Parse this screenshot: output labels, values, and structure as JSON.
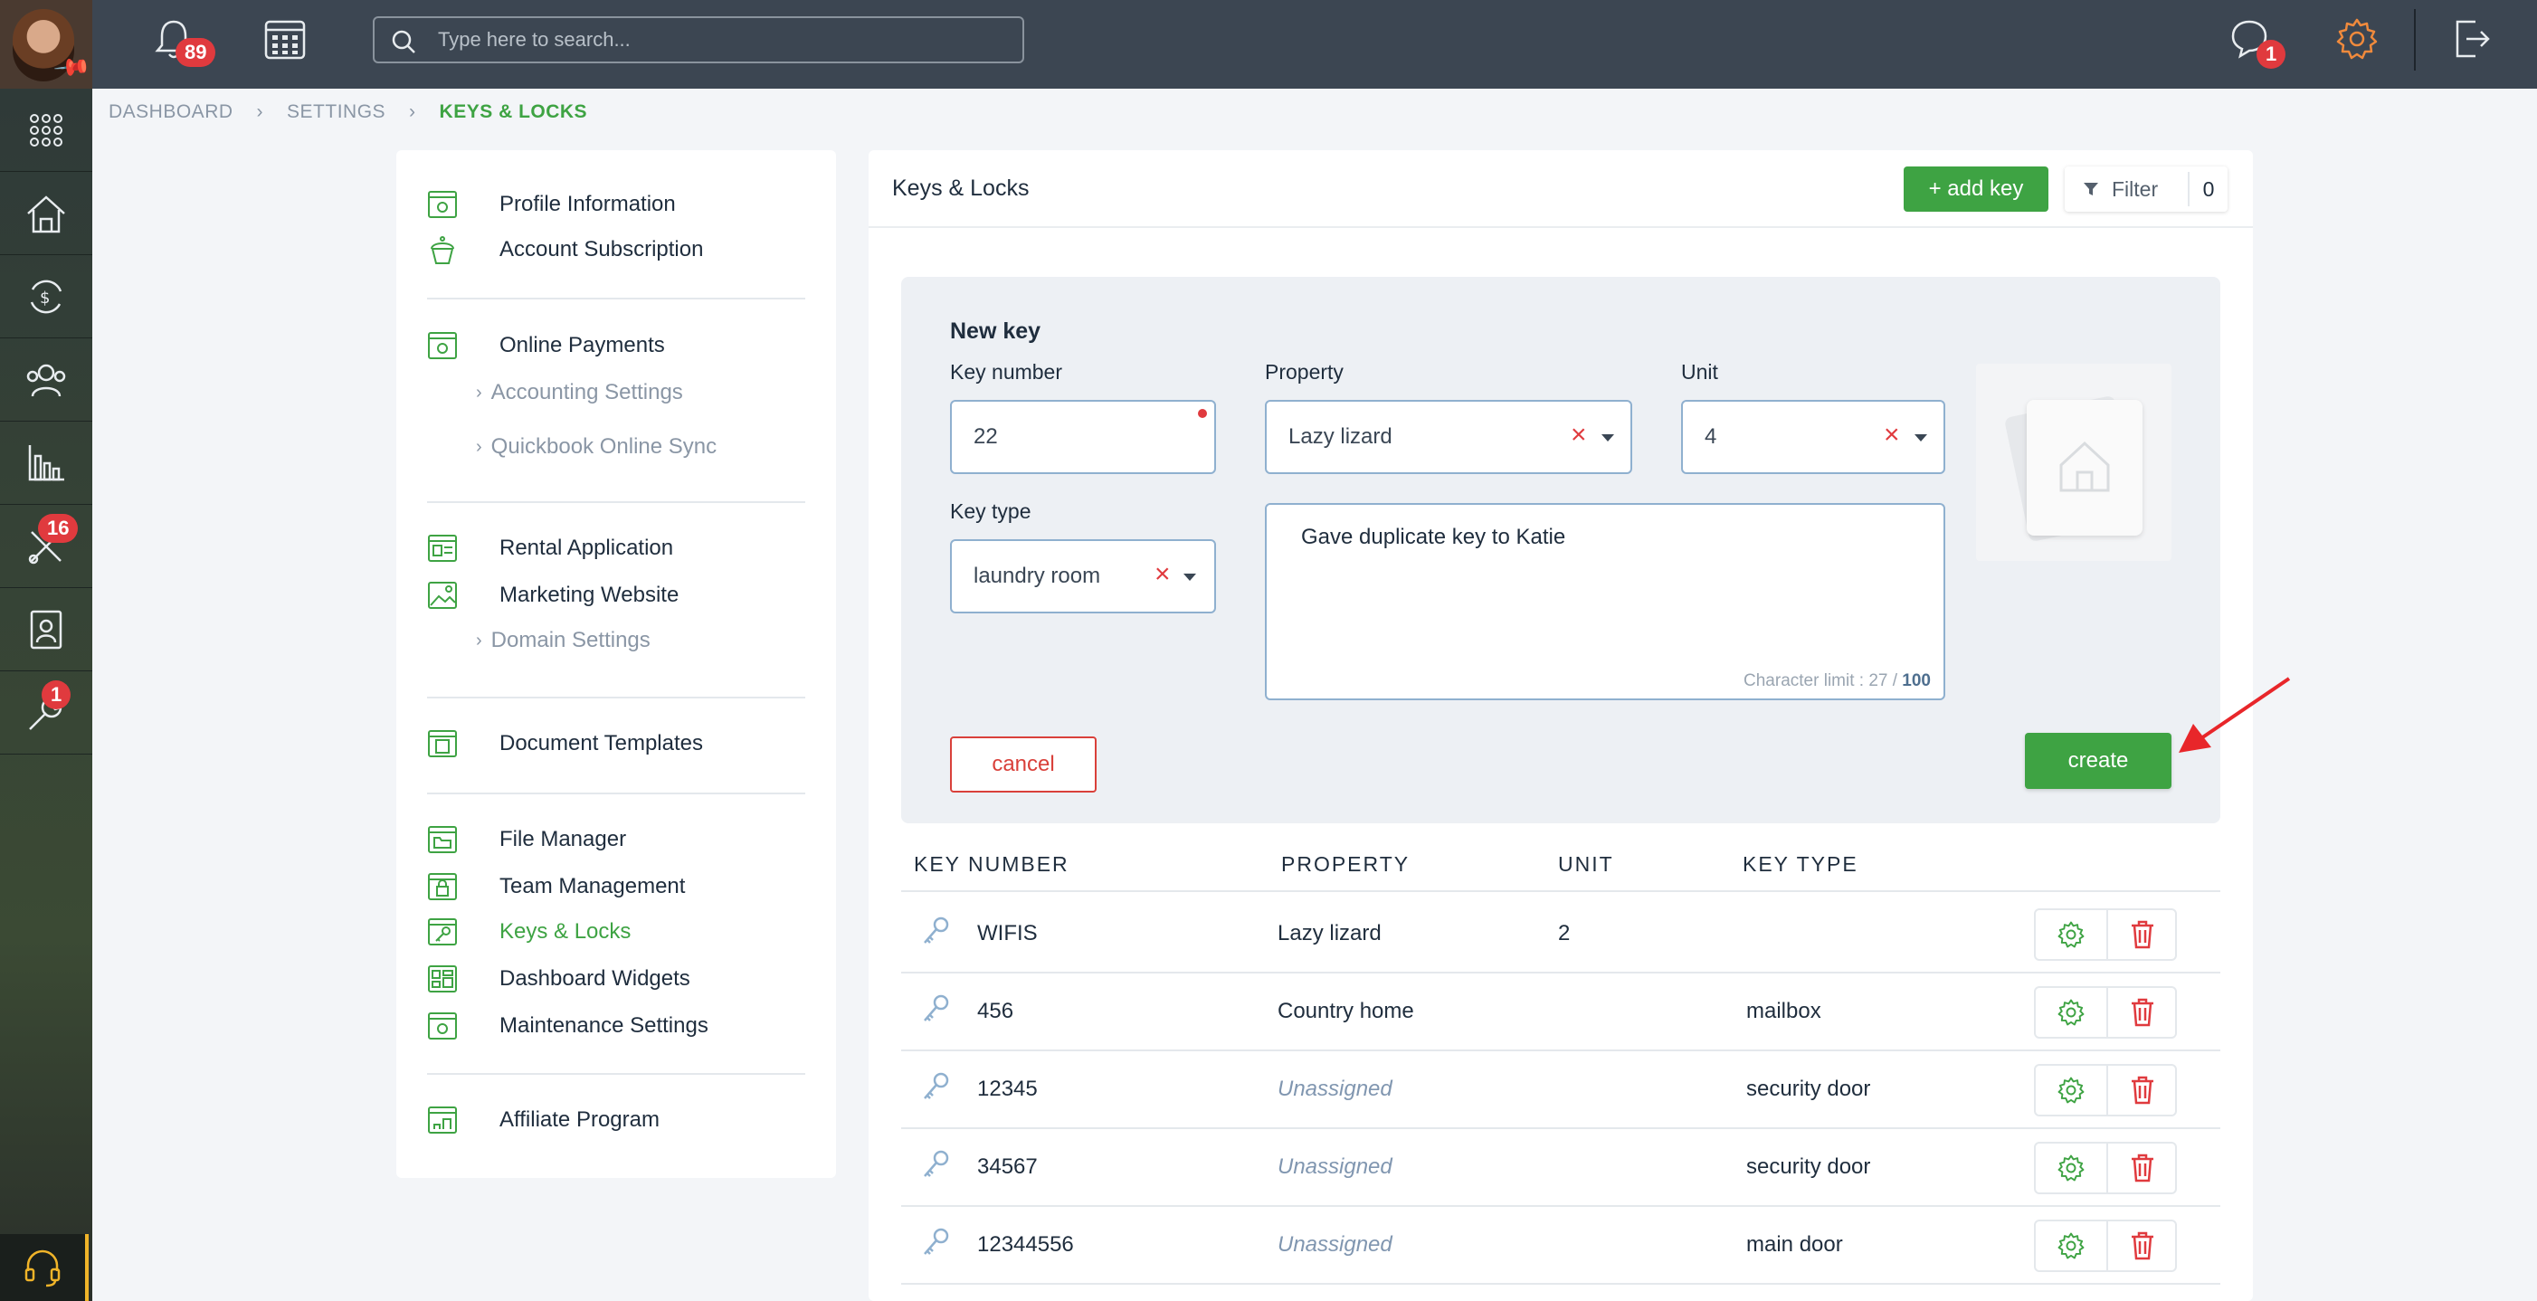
{
  "topbar": {
    "notifications_count": "89",
    "search_placeholder": "Type here to search...",
    "messages_count": "1"
  },
  "rail": {
    "maintenance_badge": "16",
    "tools_badge": "1"
  },
  "breadcrumb": [
    "DASHBOARD",
    "SETTINGS",
    "KEYS & LOCKS"
  ],
  "menu": {
    "profile": "Profile Information",
    "subscription": "Account Subscription",
    "online_payments": "Online Payments",
    "accounting": "Accounting Settings",
    "quickbook": "Quickbook Online Sync",
    "rental_app": "Rental Application",
    "marketing": "Marketing Website",
    "domain": "Domain Settings",
    "documents": "Document Templates",
    "file_manager": "File Manager",
    "team": "Team Management",
    "keys": "Keys & Locks",
    "widgets": "Dashboard Widgets",
    "maintenance": "Maintenance Settings",
    "affiliate": "Affiliate Program"
  },
  "header": {
    "title": "Keys & Locks",
    "add_key": "+ add key",
    "filter": "Filter",
    "filter_count": "0"
  },
  "form": {
    "title": "New key",
    "key_number_label": "Key number",
    "key_number_value": "22",
    "property_label": "Property",
    "property_value": "Lazy lizard",
    "unit_label": "Unit",
    "unit_value": "4",
    "key_type_label": "Key type",
    "key_type_value": "laundry room",
    "notes_value": "Gave duplicate key to Katie",
    "char_limit_prefix": "Character limit : 27 / ",
    "char_limit_max": "100",
    "cancel": "cancel",
    "create": "create"
  },
  "table": {
    "headers": [
      "KEY NUMBER",
      "PROPERTY",
      "UNIT",
      "KEY TYPE"
    ],
    "rows": [
      {
        "key": "WIFIS",
        "property": "Lazy lizard",
        "unit": "2",
        "type": ""
      },
      {
        "key": "456",
        "property": "Country home",
        "unit": "",
        "type": "mailbox"
      },
      {
        "key": "12345",
        "property": "Unassigned",
        "unit": "",
        "type": "security door"
      },
      {
        "key": "34567",
        "property": "Unassigned",
        "unit": "",
        "type": "security door"
      },
      {
        "key": "12344556",
        "property": "Unassigned",
        "unit": "",
        "type": "main door"
      }
    ]
  },
  "colors": {
    "accent": "#3ea343",
    "danger": "#e03a3e",
    "topbar": "#3c4652"
  }
}
